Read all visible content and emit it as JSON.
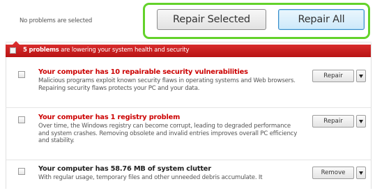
{
  "toolbar": {
    "status_text": "No problems are selected",
    "repair_selected_label": "Repair Selected",
    "repair_all_label": "Repair All",
    "highlight_color": "#63d22a"
  },
  "summary": {
    "count_text": "5 problems",
    "rest_text": " are lowering your system health and security",
    "bar_color": "#c81e1e"
  },
  "problems": [
    {
      "title": "Your computer has 10 repairable security vulnerabilities",
      "description": "Malicious programs exploit known security flaws in operating systems and Web browsers. Repairing security flaws protects your PC and your data.",
      "action": "Repair"
    },
    {
      "title": "Your computer has 1 registry problem",
      "description": "Over time, the Windows registry can become corrupt, leading to degraded performance and system crashes. Removing obsolete and invalid entries improves overall PC efficiency and stability.",
      "action": "Repair"
    },
    {
      "title": "Your computer has 58.76 MB of system clutter",
      "description": "With regular usage, temporary files and other unneeded debris accumulate. It",
      "action": "Remove"
    }
  ]
}
